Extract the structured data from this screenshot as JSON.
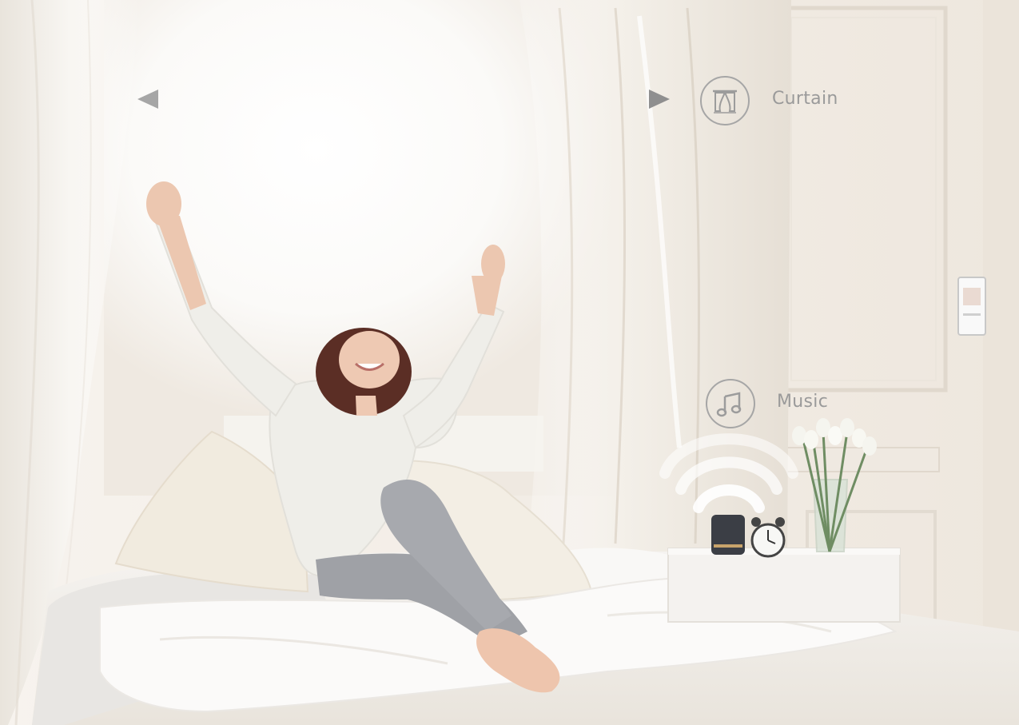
{
  "overlay": {
    "curtain_label": "Curtain",
    "music_label": "Music",
    "curtain_icon": "curtain-icon",
    "music_icon": "music-note-icon"
  },
  "colors": {
    "overlay_gray": "#9a9a9a",
    "wall": "#f3eee7",
    "window_glow": "#ffffff",
    "bedding": "#f2f0ed",
    "sweater": "#efeee9",
    "leggings": "#9fa1a6"
  }
}
